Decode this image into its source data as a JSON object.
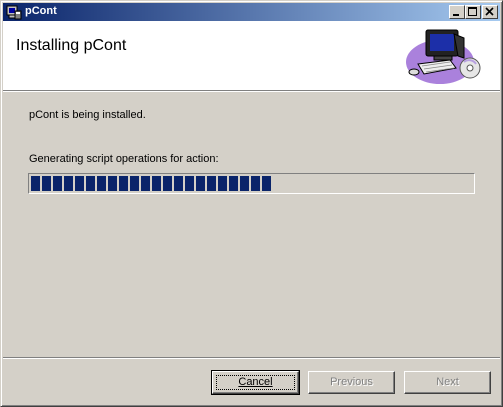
{
  "window": {
    "title": "pCont",
    "header_title": "Installing pCont"
  },
  "body": {
    "status_message": "pCont is being installed.",
    "action_message": "Generating script operations for action:",
    "progress_percent": 56
  },
  "buttons": {
    "cancel": "Cancel",
    "previous": "Previous",
    "next": "Next"
  },
  "colors": {
    "titlebar_start": "#0a246a",
    "titlebar_end": "#a6caf0",
    "progress_block": "#0a246a",
    "dialog_face": "#d4d0c8"
  },
  "icons": {
    "app": "installer-app-icon",
    "minimize": "minimize-icon",
    "maximize": "maximize-icon",
    "close": "close-icon",
    "header_graphic": "computer-with-disc-graphic"
  }
}
